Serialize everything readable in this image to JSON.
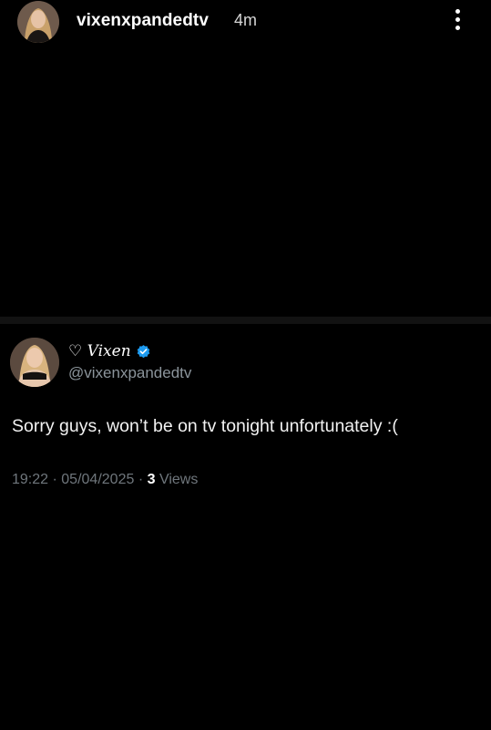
{
  "story": {
    "username": "vixenxpandedtv",
    "time_ago": "4m",
    "more_icon": "vertical-dots-icon"
  },
  "tweet": {
    "display_name": "♡ Vixen",
    "verified_icon": "verified-badge-icon",
    "verified_color": "#1d9bf0",
    "handle": "@vixenxpandedtv",
    "text": "Sorry guys, won’t be on tv tonight unfortunately :(",
    "time": "19:22",
    "separator": "·",
    "date": "05/04/2025",
    "views_count": "3",
    "views_label": "Views"
  },
  "colors": {
    "background": "#000000",
    "divider": "#121212",
    "secondary_text": "#8b949b"
  }
}
